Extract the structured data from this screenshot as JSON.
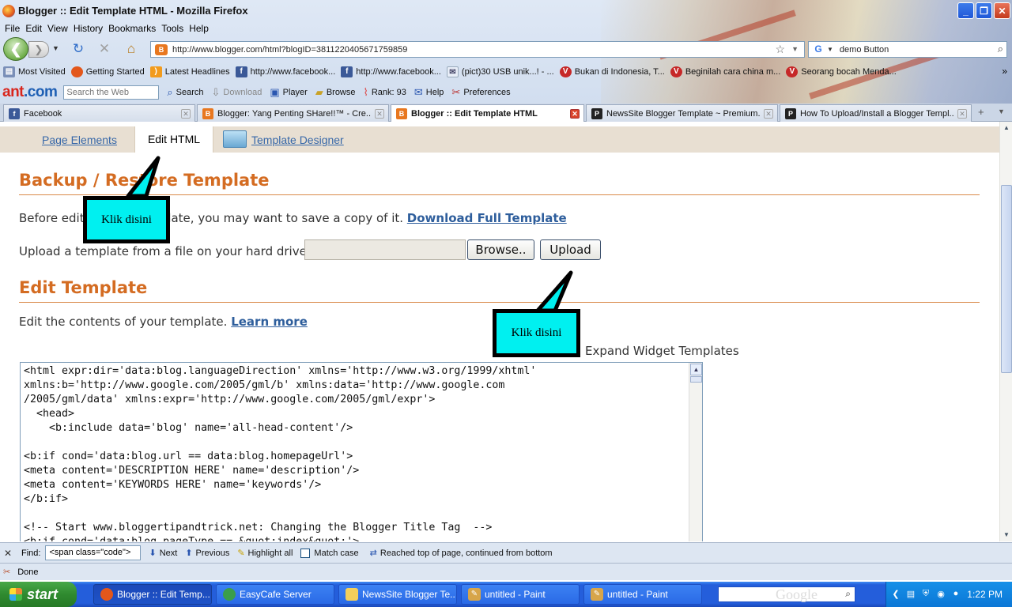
{
  "window": {
    "title": "Blogger :: Edit Template HTML - Mozilla Firefox"
  },
  "menu": [
    "File",
    "Edit",
    "View",
    "History",
    "Bookmarks",
    "Tools",
    "Help"
  ],
  "nav": {
    "url": "http://www.blogger.com/html?blogID=3811220405671759859",
    "search_value": "demo Button"
  },
  "bookmarks": {
    "items": [
      {
        "label": "Most Visited",
        "icon": "folder-icon"
      },
      {
        "label": "Getting Started",
        "icon": "firefox-icon"
      },
      {
        "label": "Latest Headlines",
        "icon": "rss-icon"
      },
      {
        "label": "http://www.facebook...",
        "icon": "facebook-icon"
      },
      {
        "label": "http://www.facebook...",
        "icon": "facebook-icon"
      },
      {
        "label": "(pict)30 USB unik...! - ...",
        "icon": "mail-icon"
      },
      {
        "label": "Bukan di Indonesia, T...",
        "icon": "vivaldi-icon"
      },
      {
        "label": "Beginilah cara china m...",
        "icon": "vivaldi-icon"
      },
      {
        "label": "Seorang bocah Menda...",
        "icon": "vivaldi-icon"
      }
    ],
    "more": "»"
  },
  "anttb": {
    "logo_a": "ant",
    "logo_b": ".com",
    "search_placeholder": "Search the Web",
    "search_label": "Search",
    "download_label": "Download",
    "player_label": "Player",
    "browse_label": "Browse",
    "rank_label": "Rank: 93",
    "help_label": "Help",
    "prefs_label": "Preferences"
  },
  "tabs": [
    {
      "label": "Facebook",
      "icon": "facebook-icon",
      "active": false
    },
    {
      "label": "Blogger: Yang Penting SHare!!™ - Cre...",
      "icon": "blogger-icon",
      "active": false
    },
    {
      "label": "Blogger :: Edit Template HTML",
      "icon": "blogger-icon",
      "active": true
    },
    {
      "label": "NewsSite Blogger Template ~ Premium...",
      "icon": "pbt-icon",
      "active": false
    },
    {
      "label": "How To Upload/Install a Blogger Templ...",
      "icon": "pbt-icon",
      "active": false
    }
  ],
  "page": {
    "subnav": {
      "page_elements": "Page Elements",
      "edit_html": "Edit HTML",
      "template_designer": "Template Designer"
    },
    "backup": {
      "title": "Backup / Restore Template",
      "before_text": "Before editing your template, you may want to save a copy of it.",
      "download_link": "Download Full Template",
      "upload_label": "Upload a template from a file on your hard drive:",
      "browse_button": "Browse..",
      "upload_button": "Upload"
    },
    "edit": {
      "title": "Edit Template",
      "desc": "Edit the contents of your template.",
      "learn_more": "Learn more",
      "expand_widgets": "Expand Widget Templates",
      "code_lines": [
        "<html expr:dir='data:blog.languageDirection' xmlns='http://www.w3.org/1999/xhtml'",
        "xmlns:b='http://www.google.com/2005/gml/b' xmlns:data='http://www.google.com",
        "/2005/gml/data' xmlns:expr='http://www.google.com/2005/gml/expr'>",
        "  <head>",
        "    <b:include data='blog' name='all-head-content'/>",
        "",
        "<b:if cond='data:blog.url == data:blog.homepageUrl'>",
        "<meta content='DESCRIPTION HERE' name='description'/>",
        "<meta content='KEYWORDS HERE' name='keywords'/>",
        "</b:if>",
        "",
        "<!-- Start www.bloggertipandtrick.net: Changing the Blogger Title Tag  -->",
        "<b:if cond='data:blog.pageType == &quot;index&quot;'>"
      ]
    }
  },
  "callouts": [
    "Klik disini",
    "Klik disini"
  ],
  "findbar": {
    "label": "Find:",
    "value": "<span class=\"code\">",
    "next": "Next",
    "previous": "Previous",
    "highlight": "Highlight all",
    "match_case": "Match case",
    "status": "Reached top of page, continued from bottom"
  },
  "status": {
    "text": "Done"
  },
  "taskbar": {
    "start": "start",
    "items": [
      {
        "label": "Blogger :: Edit Temp...",
        "icon": "firefox-icon",
        "active": true
      },
      {
        "label": "EasyCafe Server",
        "icon": "globe-icon",
        "active": false
      },
      {
        "label": "NewsSite Blogger Te...",
        "icon": "folder-icon",
        "active": false
      },
      {
        "label": "untitled - Paint",
        "icon": "paint-icon",
        "active": false
      },
      {
        "label": "untitled - Paint",
        "icon": "paint-icon",
        "active": false
      }
    ],
    "search_logo": "Google",
    "clock": "1:22 PM"
  },
  "colors": {
    "heading": "#d46c22",
    "link": "#2e5e9c",
    "callout": "#00f0f0",
    "taskbar": "#245edb"
  }
}
